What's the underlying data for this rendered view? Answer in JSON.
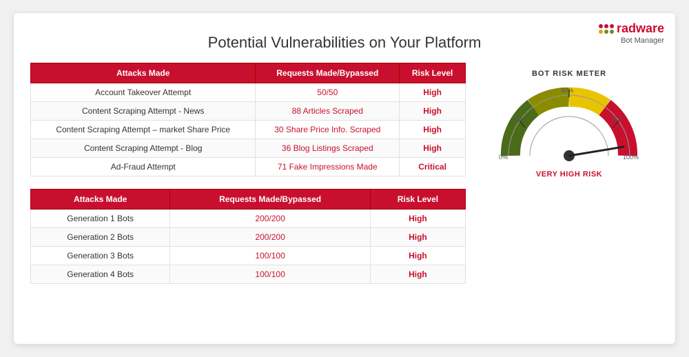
{
  "logo": {
    "brand": "radware",
    "sub": "Bot Manager",
    "dots": [
      {
        "color": "#c8102e"
      },
      {
        "color": "#c8102e"
      },
      {
        "color": "#c8102e"
      },
      {
        "color": "#e8a000"
      },
      {
        "color": "#6a8c2e"
      },
      {
        "color": "#6a8c2e"
      }
    ]
  },
  "page": {
    "title": "Potential Vulnerabilities on Your Platform"
  },
  "table1": {
    "headers": [
      "Attacks Made",
      "Requests Made/Bypassed",
      "Risk Level"
    ],
    "rows": [
      [
        "Account Takeover Attempt",
        "50/50",
        "High"
      ],
      [
        "Content Scraping Attempt - News",
        "88 Articles Scraped",
        "High"
      ],
      [
        "Content Scraping Attempt – market Share Price",
        "30 Share Price Info. Scraped",
        "High"
      ],
      [
        "Content Scraping Attempt - Blog",
        "36 Blog Listings Scraped",
        "High"
      ],
      [
        "Ad-Fraud Attempt",
        "71 Fake Impressions Made",
        "Critical"
      ]
    ]
  },
  "table2": {
    "headers": [
      "Attacks Made",
      "Requests Made/Bypassed",
      "Risk Level"
    ],
    "rows": [
      [
        "Generation 1 Bots",
        "200/200",
        "High"
      ],
      [
        "Generation 2 Bots",
        "200/200",
        "High"
      ],
      [
        "Generation 3 Bots",
        "100/100",
        "High"
      ],
      [
        "Generation 4 Bots",
        "100/100",
        "High"
      ]
    ]
  },
  "gauge": {
    "title": "BOT RISK METER",
    "labels": [
      "0%",
      "25%",
      "50%",
      "75%",
      "100%"
    ],
    "needle_angle": 165,
    "risk_label": "VERY HIGH RISK"
  }
}
